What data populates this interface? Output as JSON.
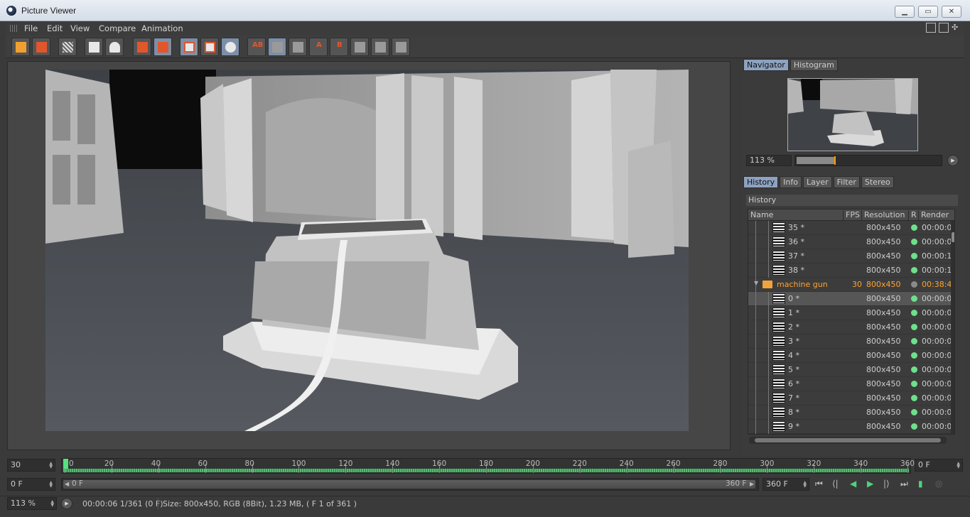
{
  "window": {
    "title": "Picture Viewer"
  },
  "menu": [
    "File",
    "Edit",
    "View",
    "Compare",
    "Animation"
  ],
  "toolbar": {
    "ab_label": "AB",
    "a_label": "A",
    "b_label": "B"
  },
  "navigator": {
    "tabs": [
      "Navigator",
      "Histogram"
    ],
    "zoom": "113 %",
    "zoom_fraction": 0.27
  },
  "history": {
    "tabs": [
      "History",
      "Info",
      "Layer",
      "Filter",
      "Stereo"
    ],
    "header": "History",
    "columns": [
      "Name",
      "FPS",
      "Resolution",
      "R",
      "Render"
    ],
    "rows": [
      {
        "name": "35 *",
        "fps": "",
        "res": "800x450",
        "time": "00:00:0"
      },
      {
        "name": "36 *",
        "fps": "",
        "res": "800x450",
        "time": "00:00:0"
      },
      {
        "name": "37 *",
        "fps": "",
        "res": "800x450",
        "time": "00:00:1"
      },
      {
        "name": "38 *",
        "fps": "",
        "res": "800x450",
        "time": "00:00:1"
      },
      {
        "name": "machine gun",
        "fps": "30",
        "res": "800x450",
        "time": "00:38:4",
        "folder": true
      },
      {
        "name": "0 *",
        "fps": "",
        "res": "800x450",
        "time": "00:00:0",
        "selected": true
      },
      {
        "name": "1 *",
        "fps": "",
        "res": "800x450",
        "time": "00:00:0"
      },
      {
        "name": "2 *",
        "fps": "",
        "res": "800x450",
        "time": "00:00:0"
      },
      {
        "name": "3 *",
        "fps": "",
        "res": "800x450",
        "time": "00:00:0"
      },
      {
        "name": "4 *",
        "fps": "",
        "res": "800x450",
        "time": "00:00:0"
      },
      {
        "name": "5 *",
        "fps": "",
        "res": "800x450",
        "time": "00:00:0"
      },
      {
        "name": "6 *",
        "fps": "",
        "res": "800x450",
        "time": "00:00:0"
      },
      {
        "name": "7 *",
        "fps": "",
        "res": "800x450",
        "time": "00:00:0"
      },
      {
        "name": "8 *",
        "fps": "",
        "res": "800x450",
        "time": "00:00:0"
      },
      {
        "name": "9 *",
        "fps": "",
        "res": "800x450",
        "time": "00:00:0"
      }
    ]
  },
  "timeline": {
    "fps": "30",
    "start_frame": "0 F",
    "end_frame_field": "0 F",
    "ticks": [
      "0",
      "20",
      "40",
      "60",
      "80",
      "100",
      "120",
      "140",
      "160",
      "180",
      "200",
      "220",
      "240",
      "260",
      "280",
      "300",
      "320",
      "340",
      "360"
    ],
    "max_frame": 360,
    "current_frame": 0,
    "range_start": "0 F",
    "range_end": "360 F",
    "range_end_field": "360 F"
  },
  "status": {
    "zoom": "113 %",
    "time": "00:00:06 1/361 (0 F)",
    "info": "Size: 800x450, RGB (8Bit), 1.23 MB,  ( F 1 of 361 )"
  }
}
